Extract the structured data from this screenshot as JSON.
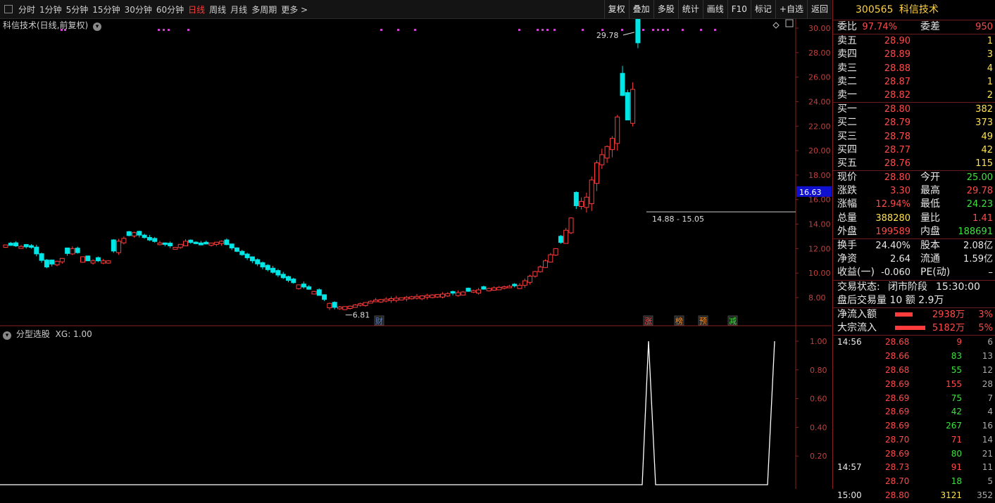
{
  "toolbar": {
    "periods": [
      "分时",
      "1分钟",
      "5分钟",
      "15分钟",
      "30分钟",
      "60分钟",
      "日线",
      "周线",
      "月线",
      "多周期",
      "更多 >"
    ],
    "active_period": "日线",
    "right_tools": [
      "复权",
      "叠加",
      "多股",
      "统计",
      "画线",
      "F10",
      "标记",
      "+自选",
      "返回"
    ]
  },
  "main_chart": {
    "title": "科信技术(日线,前复权)",
    "price_axis": [
      "30.00",
      "28.00",
      "26.00",
      "24.00",
      "22.00",
      "20.00",
      "18.00",
      "16.00",
      "14.00",
      "12.00",
      "10.00",
      "8.00"
    ],
    "current_price_tag": "16.63",
    "high_label": "29.78",
    "low_label": "6.81",
    "range_label": "14.88 - 15.05",
    "badges": [
      {
        "text": "财",
        "color": "#4f7fd6"
      },
      {
        "text": "涨",
        "color": "#ff4a4a"
      },
      {
        "text": "榜",
        "color": "#ff8c1a"
      },
      {
        "text": "预",
        "color": "#ff8c1a"
      },
      {
        "text": "减",
        "color": "#3fe03f"
      }
    ]
  },
  "sub_chart": {
    "title": "分型选股",
    "value_text": "XG: 1.00",
    "axis": [
      "1.00",
      "0.80",
      "0.60",
      "0.40",
      "0.20"
    ]
  },
  "quote": {
    "code": "300565",
    "name": "科信技术",
    "weibi_label": "委比",
    "weibi_value": "97.74%",
    "weicha_label": "委差",
    "weicha_value": "950",
    "sells": [
      {
        "label": "卖五",
        "price": "28.90",
        "vol": "1"
      },
      {
        "label": "卖四",
        "price": "28.89",
        "vol": "3"
      },
      {
        "label": "卖三",
        "price": "28.88",
        "vol": "4"
      },
      {
        "label": "卖二",
        "price": "28.87",
        "vol": "1"
      },
      {
        "label": "卖一",
        "price": "28.82",
        "vol": "2"
      }
    ],
    "buys": [
      {
        "label": "买一",
        "price": "28.80",
        "vol": "382"
      },
      {
        "label": "买二",
        "price": "28.79",
        "vol": "373"
      },
      {
        "label": "买三",
        "price": "28.78",
        "vol": "49"
      },
      {
        "label": "买四",
        "price": "28.77",
        "vol": "42"
      },
      {
        "label": "买五",
        "price": "28.76",
        "vol": "115"
      }
    ],
    "stats": [
      {
        "l1": "现价",
        "v1": "28.80",
        "c1": "red",
        "l2": "今开",
        "v2": "25.00",
        "c2": "green"
      },
      {
        "l1": "涨跌",
        "v1": "3.30",
        "c1": "red",
        "l2": "最高",
        "v2": "29.78",
        "c2": "red"
      },
      {
        "l1": "涨幅",
        "v1": "12.94%",
        "c1": "red",
        "l2": "最低",
        "v2": "24.23",
        "c2": "green"
      },
      {
        "l1": "总量",
        "v1": "388280",
        "c1": "yellow",
        "l2": "量比",
        "v2": "1.41",
        "c2": "red"
      },
      {
        "l1": "外盘",
        "v1": "199589",
        "c1": "red",
        "l2": "内盘",
        "v2": "188691",
        "c2": "green"
      }
    ],
    "fundamentals": [
      {
        "l1": "换手",
        "v1": "24.40%",
        "l2": "股本",
        "v2": "2.08亿"
      },
      {
        "l1": "净资",
        "v1": "2.64",
        "l2": "流通",
        "v2": "1.59亿"
      },
      {
        "l1": "收益(一)",
        "v1": "-0.060",
        "l2": "PE(动)",
        "v2": "–"
      }
    ],
    "trade_state_label": "交易状态:",
    "trade_state_value": "闭市阶段",
    "trade_time": "15:30:00",
    "after_hours": "盘后交易量 10 额 2.9万",
    "flows": [
      {
        "label": "净流入额",
        "value": "2938万",
        "pct": "3%",
        "bar": 0.35
      },
      {
        "label": "大宗流入",
        "value": "5182万",
        "pct": "5%",
        "bar": 0.62
      }
    ],
    "ticks": [
      {
        "time": "14:56",
        "price": "28.68",
        "vol": "9",
        "vc": "red",
        "n": "6"
      },
      {
        "time": "",
        "price": "28.66",
        "vol": "83",
        "vc": "green",
        "n": "13"
      },
      {
        "time": "",
        "price": "28.68",
        "vol": "55",
        "vc": "green",
        "n": "12"
      },
      {
        "time": "",
        "price": "28.69",
        "vol": "155",
        "vc": "red",
        "n": "28"
      },
      {
        "time": "",
        "price": "28.69",
        "vol": "75",
        "vc": "green",
        "n": "7"
      },
      {
        "time": "",
        "price": "28.69",
        "vol": "42",
        "vc": "green",
        "n": "4"
      },
      {
        "time": "",
        "price": "28.69",
        "vol": "267",
        "vc": "green",
        "n": "16"
      },
      {
        "time": "",
        "price": "28.70",
        "vol": "71",
        "vc": "red",
        "n": "14"
      },
      {
        "time": "",
        "price": "28.69",
        "vol": "80",
        "vc": "green",
        "n": "21"
      },
      {
        "time": "14:57",
        "price": "28.73",
        "vol": "91",
        "vc": "red",
        "n": "11"
      },
      {
        "time": "",
        "price": "28.70",
        "vol": "18",
        "vc": "green",
        "n": "5"
      },
      {
        "time": "15:00",
        "price": "28.80",
        "vol": "3121",
        "vc": "yellow",
        "n": "352"
      }
    ]
  },
  "colors": {
    "up": "#ff3b3b",
    "down": "#00e5e5",
    "grid": "#8a1f1f",
    "bg": "#000000"
  }
}
